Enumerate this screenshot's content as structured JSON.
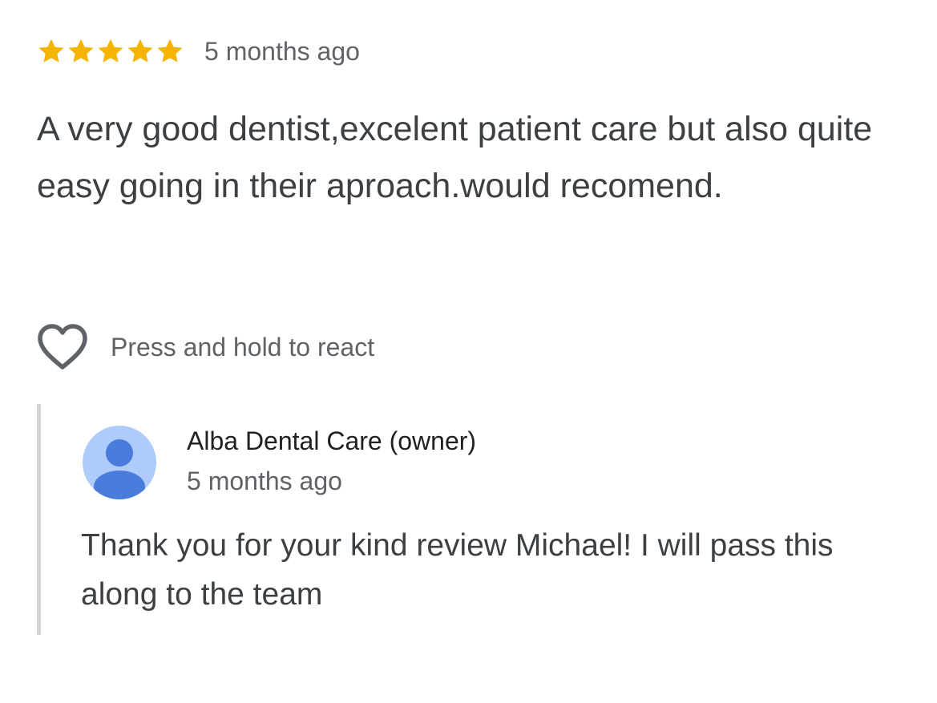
{
  "review": {
    "rating": 5,
    "max_rating": 5,
    "time": "5 months ago",
    "text": "A very good dentist,excelent patient care but also quite easy going in their aproach.would recomend.",
    "star_color": "#f4b400"
  },
  "reaction": {
    "icon": "heart-outline-icon",
    "label": "Press and hold to react"
  },
  "owner_reply": {
    "avatar_icon": "person-avatar-icon",
    "avatar_bg_color": "#aecbfa",
    "avatar_fg_color": "#4a7ddb",
    "name": "Alba Dental Care (owner)",
    "time": "5 months ago",
    "text": "Thank you for your kind review Michael! I will pass this along to the team"
  }
}
